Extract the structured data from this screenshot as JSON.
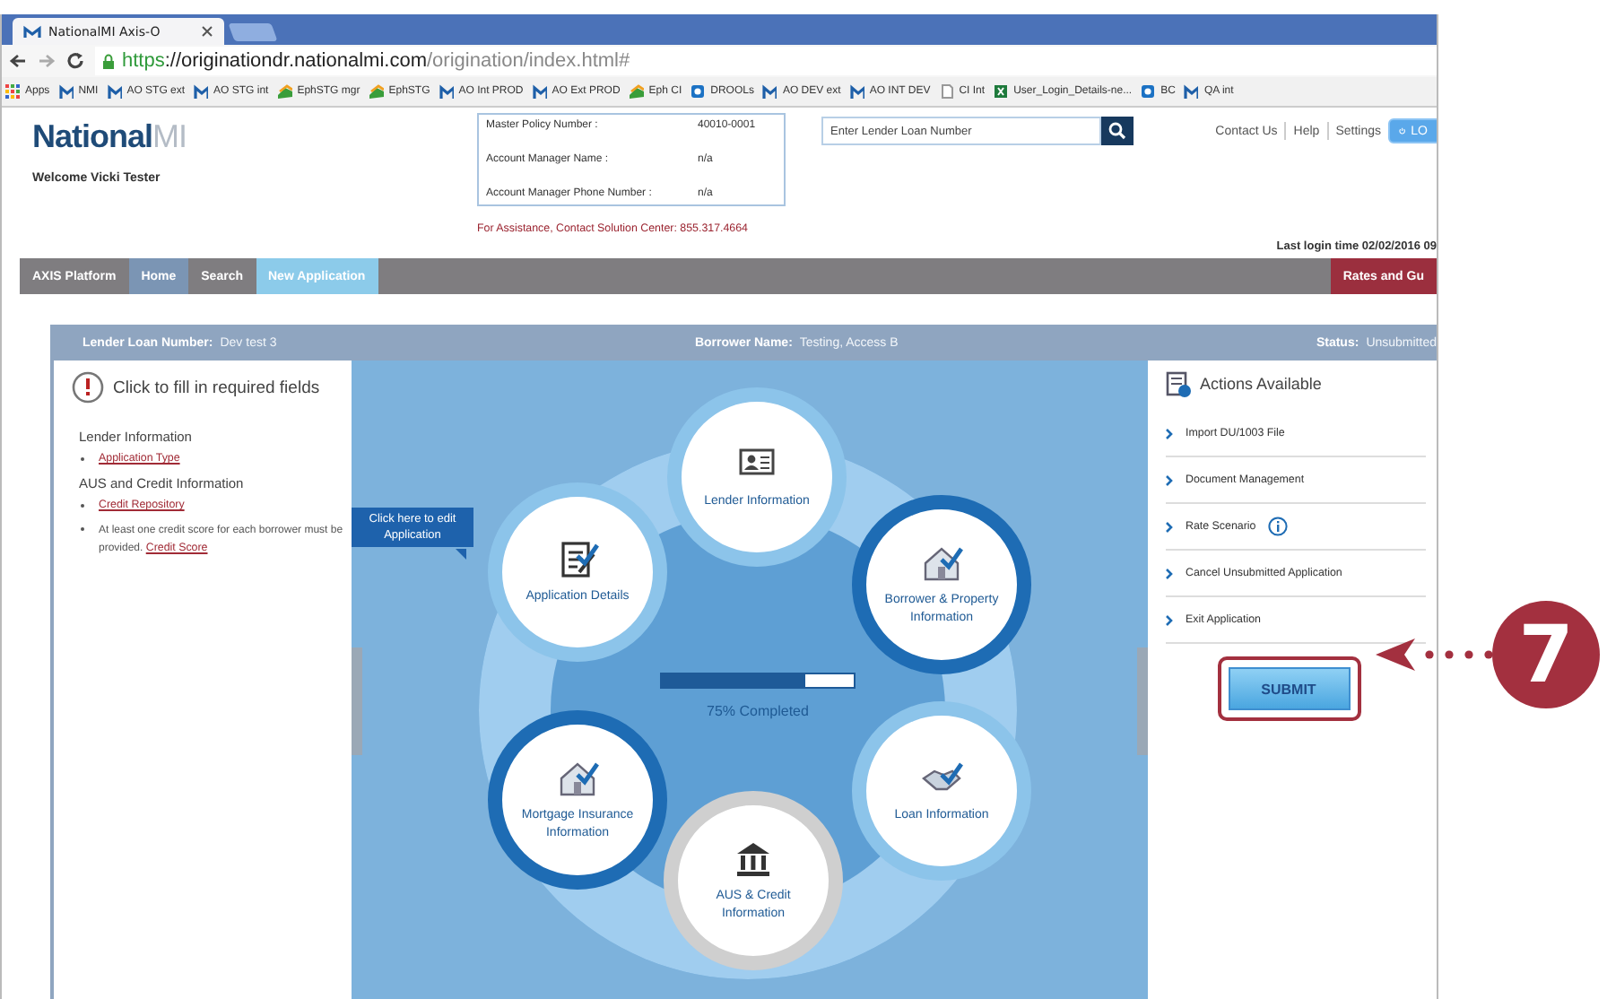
{
  "browser": {
    "tabs": [
      {
        "title": "NationalMI Axis-O",
        "selected": true
      }
    ],
    "url": {
      "scheme": "https",
      "host": "://originationdr.nationalmi.com",
      "path": "/origination/index.html#"
    },
    "bookmarks": [
      {
        "label": "Apps",
        "kind": "apps"
      },
      {
        "label": "NMI",
        "kind": "mi"
      },
      {
        "label": "AO STG ext",
        "kind": "mi"
      },
      {
        "label": "AO STG int",
        "kind": "mi"
      },
      {
        "label": "EphSTG mgr",
        "kind": "eph"
      },
      {
        "label": "EphSTG",
        "kind": "eph"
      },
      {
        "label": "AO Int PROD",
        "kind": "mi"
      },
      {
        "label": "AO Ext PROD",
        "kind": "mi"
      },
      {
        "label": "Eph CI",
        "kind": "eph"
      },
      {
        "label": "DROOLs",
        "kind": "sp"
      },
      {
        "label": "AO DEV ext",
        "kind": "mi"
      },
      {
        "label": "AO INT DEV",
        "kind": "mi"
      },
      {
        "label": "CI Int",
        "kind": "page"
      },
      {
        "label": "User_Login_Details-ne...",
        "kind": "excel"
      },
      {
        "label": "BC",
        "kind": "sp"
      },
      {
        "label": "QA int",
        "kind": "mi"
      }
    ]
  },
  "header": {
    "logo": {
      "brand": "National",
      "mark": "MI"
    },
    "welcome": "Welcome Vicki Tester",
    "info": [
      {
        "label": "Master Policy Number :",
        "value": "40010-0001"
      },
      {
        "label": "Account Manager Name :",
        "value": "n/a"
      },
      {
        "label": "Account Manager Phone Number :",
        "value": "n/a"
      }
    ],
    "assistance": "For Assistance, Contact Solution Center: 855.317.4664",
    "search": {
      "placeholder": "Enter Lender Loan Number"
    },
    "links": [
      "Contact Us",
      "Help",
      "Settings"
    ],
    "logout": "LO",
    "last_login": "Last login time 02/02/2016 09"
  },
  "nav": [
    {
      "label": "AXIS Platform",
      "color": "#7f7d80"
    },
    {
      "label": "Home",
      "color": "#7b95b4"
    },
    {
      "label": "Search",
      "color": "#7f7d80"
    },
    {
      "label": "New Application",
      "color": "#8ccbea"
    }
  ],
  "nav_right": {
    "label": "Rates and Gu",
    "color": "#9b2f3e"
  },
  "loan_bar": [
    {
      "label": "Lender Loan Number:",
      "value": "Dev test 3"
    },
    {
      "label": "Borrower Name:",
      "value": "Testing, Access B"
    },
    {
      "label": "Status:",
      "value": "Unsubmitted"
    }
  ],
  "required": {
    "title": "Click to fill in required fields",
    "sections": [
      {
        "heading": "Lender Information",
        "items": [
          {
            "kind": "link",
            "text": "Application Type"
          }
        ]
      },
      {
        "heading": "AUS and Credit Information",
        "items": [
          {
            "kind": "link",
            "text": "Credit Repository"
          },
          {
            "kind": "note",
            "text": "At least one credit score for each borrower must be provided.",
            "link": "Credit Score"
          }
        ]
      }
    ]
  },
  "tooltip": "Click here to edit Application",
  "steps": [
    {
      "label": "Lender Information",
      "kind": "id",
      "color": "#8cc4ea",
      "complete": false
    },
    {
      "label": "Application Details",
      "kind": "form",
      "color": "#8cc4ea",
      "complete": true
    },
    {
      "label": "Borrower & Property Information",
      "kind": "house",
      "color": "#1e6cb4",
      "complete": true
    },
    {
      "label": "Mortgage Insurance Information",
      "kind": "house",
      "color": "#1e6cb4",
      "complete": true
    },
    {
      "label": "Loan Information",
      "kind": "handshake",
      "color": "#8cc4ea",
      "complete": true
    },
    {
      "label": "AUS & Credit Information",
      "kind": "bank",
      "color": "#cfcfcf",
      "complete": false
    }
  ],
  "progress": {
    "level": 0.75,
    "label": "75% Completed"
  },
  "actions": {
    "title": "Actions Available",
    "items": [
      {
        "label": "Import DU/1003 File",
        "info": false
      },
      {
        "label": "Document Management",
        "info": false
      },
      {
        "label": "Rate Scenario",
        "info": true
      },
      {
        "label": "Cancel Unsubmitted Application",
        "info": false
      },
      {
        "label": "Exit Application",
        "info": false
      }
    ],
    "submit": "SUBMIT"
  },
  "callout": {
    "number": "7"
  }
}
